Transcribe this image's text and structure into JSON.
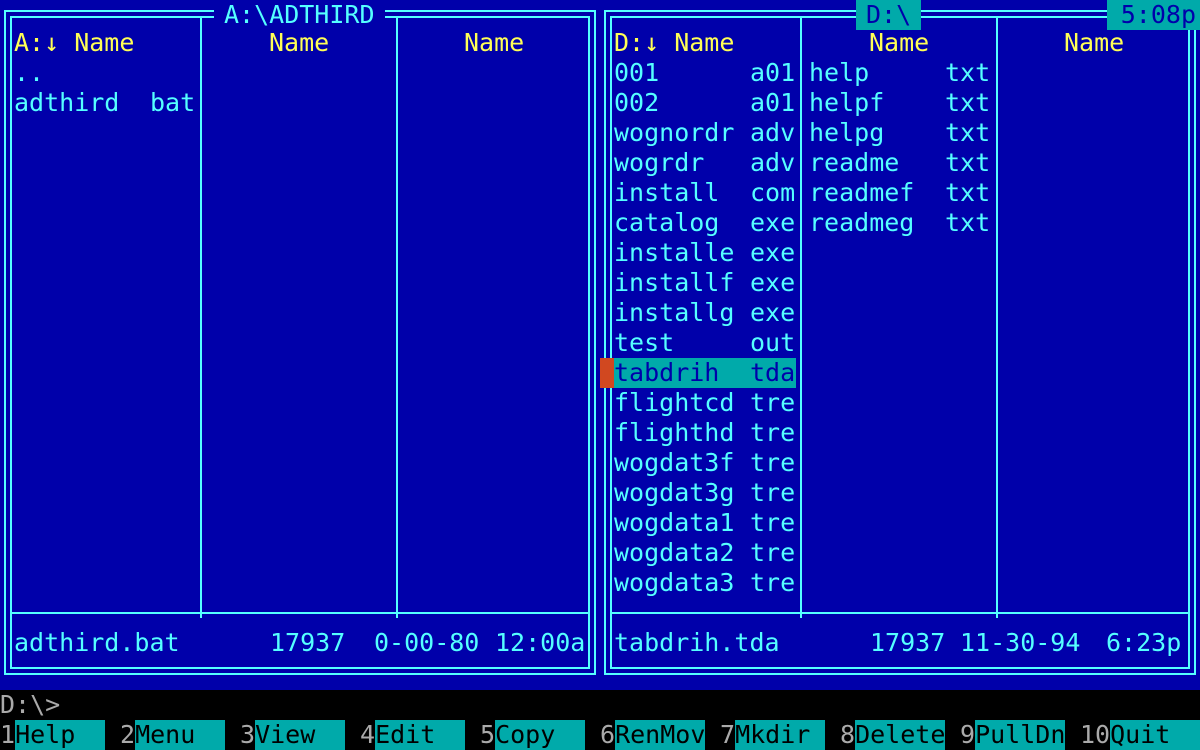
{
  "clock": "5:08p",
  "command_line": "D:\\>",
  "left_panel": {
    "title": "A:\\ADTHIRD",
    "col_headers": [
      "A:↓ Name",
      "Name",
      "Name"
    ],
    "files": [
      {
        "name": "..",
        "ext": ""
      },
      {
        "name": "adthird",
        "ext": "bat"
      }
    ],
    "status": {
      "file": "adthird.bat",
      "size": "17937",
      "date": "0-00-80",
      "time": "12:00a"
    }
  },
  "right_panel": {
    "title": "D:\\",
    "col_headers": [
      "D:↓ Name",
      "Name",
      "Name"
    ],
    "column1": [
      {
        "name": "001",
        "ext": "a01"
      },
      {
        "name": "002",
        "ext": "a01"
      },
      {
        "name": "wognordr",
        "ext": "adv"
      },
      {
        "name": "wogrdr",
        "ext": "adv"
      },
      {
        "name": "install",
        "ext": "com"
      },
      {
        "name": "catalog",
        "ext": "exe"
      },
      {
        "name": "installe",
        "ext": "exe"
      },
      {
        "name": "installf",
        "ext": "exe"
      },
      {
        "name": "installg",
        "ext": "exe"
      },
      {
        "name": "test",
        "ext": "out"
      },
      {
        "name": "tabdrih",
        "ext": "tda"
      },
      {
        "name": "flightcd",
        "ext": "tre"
      },
      {
        "name": "flighthd",
        "ext": "tre"
      },
      {
        "name": "wogdat3f",
        "ext": "tre"
      },
      {
        "name": "wogdat3g",
        "ext": "tre"
      },
      {
        "name": "wogdata1",
        "ext": "tre"
      },
      {
        "name": "wogdata2",
        "ext": "tre"
      },
      {
        "name": "wogdata3",
        "ext": "tre"
      }
    ],
    "column2": [
      {
        "name": "help",
        "ext": "txt"
      },
      {
        "name": "helpf",
        "ext": "txt"
      },
      {
        "name": "helpg",
        "ext": "txt"
      },
      {
        "name": "readme",
        "ext": "txt"
      },
      {
        "name": "readmef",
        "ext": "txt"
      },
      {
        "name": "readmeg",
        "ext": "txt"
      }
    ],
    "selected_index": 10,
    "status": {
      "file": "tabdrih.tda",
      "size": "17937",
      "date": "11-30-94",
      "time": "6:23p"
    }
  },
  "function_keys": [
    {
      "num": "1",
      "label": "Help"
    },
    {
      "num": "2",
      "label": "Menu"
    },
    {
      "num": "3",
      "label": "View"
    },
    {
      "num": "4",
      "label": "Edit"
    },
    {
      "num": "5",
      "label": "Copy"
    },
    {
      "num": "6",
      "label": "RenMov"
    },
    {
      "num": "7",
      "label": "Mkdir"
    },
    {
      "num": "8",
      "label": "Delete"
    },
    {
      "num": "9",
      "label": "PullDn"
    },
    {
      "num": "10",
      "label": "Quit"
    }
  ],
  "colors": {
    "background": "#0000aa",
    "text": "#55ffff",
    "header": "#ffff55",
    "highlight": "#00aaaa",
    "cursor_marker": "#d14820"
  }
}
